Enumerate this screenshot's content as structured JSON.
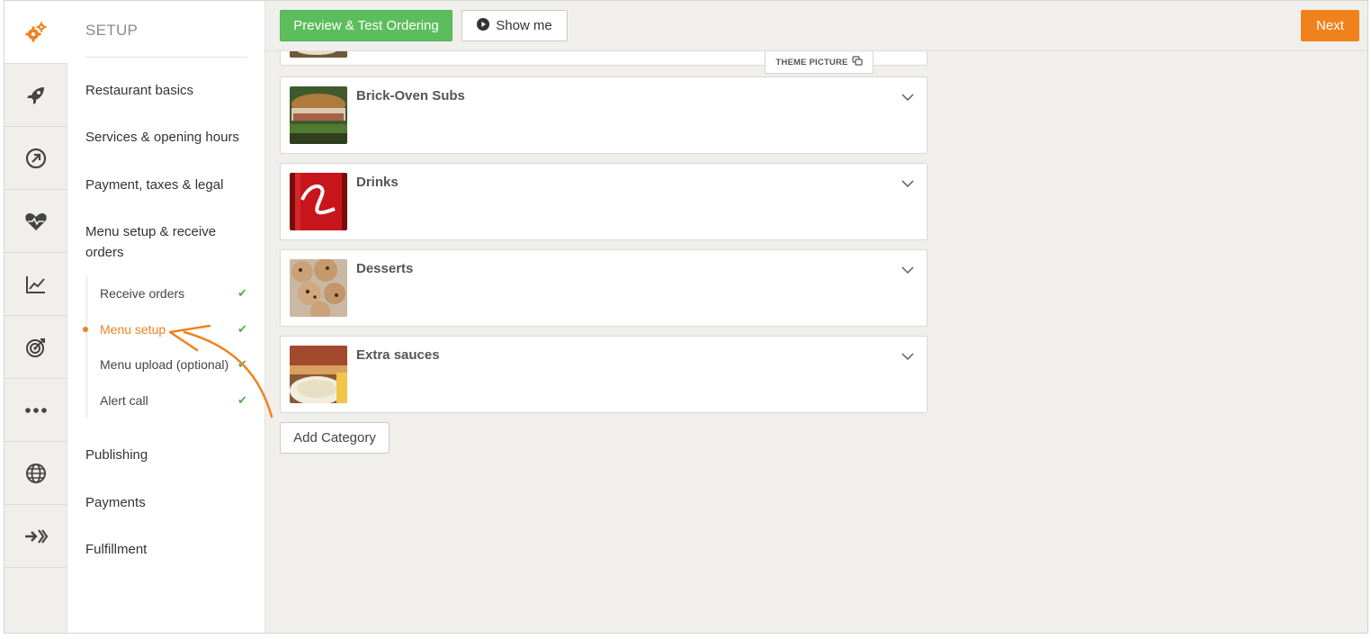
{
  "sidebar": {
    "title": "SETUP",
    "items": [
      {
        "label": "Restaurant basics"
      },
      {
        "label": "Services & opening hours"
      },
      {
        "label": "Payment, taxes & legal"
      },
      {
        "label": "Menu setup & receive orders"
      },
      {
        "label": "Publishing"
      },
      {
        "label": "Payments"
      },
      {
        "label": "Fulfillment"
      }
    ],
    "subitems": [
      {
        "label": "Receive orders",
        "done": true,
        "current": false
      },
      {
        "label": "Menu setup",
        "done": true,
        "current": true
      },
      {
        "label": "Menu upload (optional)",
        "done": true,
        "current": false
      },
      {
        "label": "Alert call",
        "done": true,
        "current": false
      }
    ],
    "check_glyph": "✔"
  },
  "rail": {
    "icons": [
      "gears-icon",
      "rocket-icon",
      "circle-arrow-icon",
      "heart-pulse-icon",
      "chart-line-icon",
      "target-icon",
      "more-dots-icon",
      "globe-icon",
      "integrations-icon"
    ]
  },
  "toolbar": {
    "preview_label": "Preview & Test Ordering",
    "show_me_label": "Show me",
    "next_label": "Next"
  },
  "content": {
    "theme_picture_label": "THEME PICTURE",
    "categories": [
      {
        "title": "Brick-Oven Subs",
        "image": "sub-sandwich-image"
      },
      {
        "title": "Drinks",
        "image": "cola-can-image"
      },
      {
        "title": "Desserts",
        "image": "cookies-image"
      },
      {
        "title": "Extra sauces",
        "image": "sauce-image"
      }
    ],
    "add_category_label": "Add Category"
  },
  "colors": {
    "accent_orange": "#f0821e",
    "green_button": "#5cbd5c",
    "check_green": "#4cb04c",
    "background": "#f0efec"
  }
}
